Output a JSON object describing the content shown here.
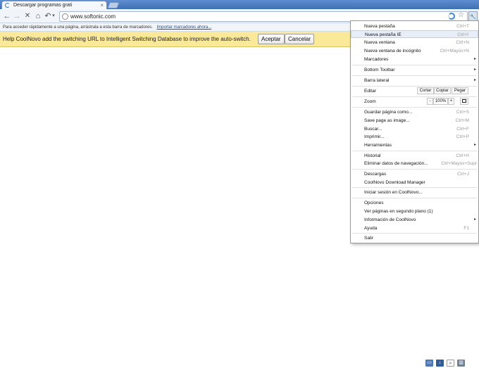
{
  "tab": {
    "title": "Descargar programas grati",
    "close": "×"
  },
  "window_controls": {
    "minimize": "–",
    "maximize": "□",
    "close": "×"
  },
  "toolbar": {
    "back": "←",
    "forward": "→",
    "stop": "✕",
    "home": "⌂",
    "undo": "↶",
    "undo_caret": "▾",
    "wrench": "🔧"
  },
  "address": {
    "url": "www.softonic.com",
    "star": "☆"
  },
  "bookmarks_bar": {
    "hint": "Para acceder rápidamente a una página, arrástrala a esta barra de marcadores.",
    "import_link": "Importar marcadores ahora..."
  },
  "infobar": {
    "message": "Help CoolNovo add the switching URL to Intelligent Switching Database to improve the auto-switch.",
    "accept": "Aceptar",
    "cancel": "Cancelar"
  },
  "menu": {
    "new_tab": {
      "label": "Nueva pestaña",
      "shortcut": "Ctrl+T"
    },
    "new_tab_ie": {
      "label": "Nueva pestaña IE",
      "shortcut": "Ctrl+I"
    },
    "new_window": {
      "label": "Nueva ventana",
      "shortcut": "Ctrl+N"
    },
    "incognito": {
      "label": "Nueva ventana de incógnito",
      "shortcut": "Ctrl+Mayús+N"
    },
    "bookmarks": {
      "label": "Marcadores"
    },
    "bottom_toolbar": {
      "label": "Bottom Toolbar"
    },
    "sidebar": {
      "label": "Barra lateral"
    },
    "edit": {
      "label": "Editar",
      "cut": "Cortar",
      "copy": "Copiar",
      "paste": "Pegar"
    },
    "zoom": {
      "label": "Zoom",
      "minus": "-",
      "value": "100%",
      "plus": "+"
    },
    "save_page": {
      "label": "Guardar página como...",
      "shortcut": "Ctrl+S"
    },
    "save_image": {
      "label": "Save page as image...",
      "shortcut": "Ctrl+M"
    },
    "find": {
      "label": "Buscar...",
      "shortcut": "Ctrl+F"
    },
    "print": {
      "label": "Imprimir...",
      "shortcut": "Ctrl+P"
    },
    "tools": {
      "label": "Herramientas"
    },
    "history": {
      "label": "Historial",
      "shortcut": "Ctrl+H"
    },
    "clear_data": {
      "label": "Eliminar datos de navegación...",
      "shortcut": "Ctrl+Mayús+Supr"
    },
    "downloads": {
      "label": "Descargas",
      "shortcut": "Ctrl+J"
    },
    "download_manager": {
      "label": "CoolNovo Download Manager"
    },
    "signin": {
      "label": "Iniciar sesión en CoolNovo..."
    },
    "options": {
      "label": "Opciones"
    },
    "background_pages": {
      "label": "Ver páginas en segundo plano (1)"
    },
    "about": {
      "label": "Información de CoolNovo"
    },
    "help": {
      "label": "Ayuda",
      "shortcut": "F1"
    },
    "exit": {
      "label": "Salir"
    },
    "submenu_arrow": "▸"
  },
  "colors": {
    "tabstrip": "#4f7fc2",
    "infobar": "#fbe99a",
    "highlight": "#e8eef7"
  },
  "status_icons": [
    "window-icon",
    "download-icon",
    "search-icon",
    "trash-icon"
  ]
}
